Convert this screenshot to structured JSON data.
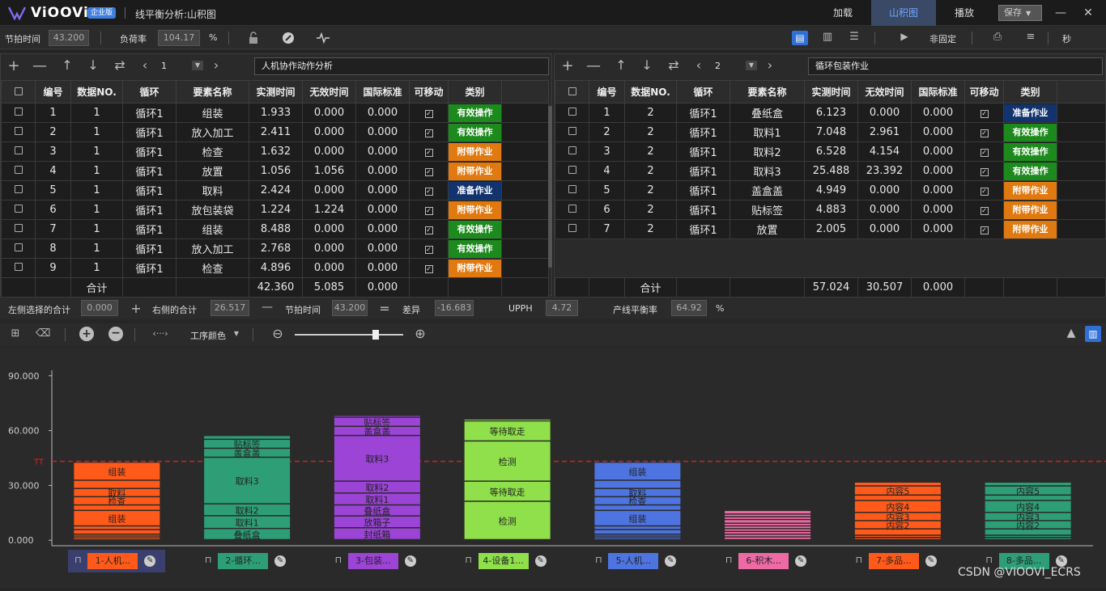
{
  "app": {
    "logo": "ViOOVi",
    "edition": "企业版",
    "title": "线平衡分析:山积图"
  },
  "titlebar": {
    "load": "加载",
    "yamazumi": "山积图",
    "play": "播放",
    "save": "保存"
  },
  "toolbar": {
    "takt_label": "节拍时间",
    "takt_value": "43.200",
    "load_label": "负荷率",
    "load_value": "104.17",
    "pct": "%",
    "mode": "非固定",
    "unit": "秒"
  },
  "left_panel": {
    "page": "1",
    "name": "人机协作动作分析",
    "headers": [
      "编号",
      "数据NO.",
      "循环",
      "要素名称",
      "实测时间",
      "无效时间",
      "国际标准",
      "可移动",
      "类别"
    ],
    "rows": [
      [
        "1",
        "1",
        "循环1",
        "组装",
        "1.933",
        "0.000",
        "0.000",
        "有效操作",
        "green"
      ],
      [
        "2",
        "1",
        "循环1",
        "放入加工",
        "2.411",
        "0.000",
        "0.000",
        "有效操作",
        "green"
      ],
      [
        "3",
        "1",
        "循环1",
        "检查",
        "1.632",
        "0.000",
        "0.000",
        "附带作业",
        "orange"
      ],
      [
        "4",
        "1",
        "循环1",
        "放置",
        "1.056",
        "1.056",
        "0.000",
        "附带作业",
        "orange"
      ],
      [
        "5",
        "1",
        "循环1",
        "取料",
        "2.424",
        "0.000",
        "0.000",
        "准备作业",
        "navy"
      ],
      [
        "6",
        "1",
        "循环1",
        "放包装袋",
        "1.224",
        "1.224",
        "0.000",
        "附带作业",
        "orange"
      ],
      [
        "7",
        "1",
        "循环1",
        "组装",
        "8.488",
        "0.000",
        "0.000",
        "有效操作",
        "green"
      ],
      [
        "8",
        "1",
        "循环1",
        "放入加工",
        "2.768",
        "0.000",
        "0.000",
        "有效操作",
        "green"
      ],
      [
        "9",
        "1",
        "循环1",
        "检查",
        "4.896",
        "0.000",
        "0.000",
        "附带作业",
        "orange"
      ]
    ],
    "total": {
      "label": "合计",
      "measured": "42.360",
      "invalid": "5.085",
      "standard": "0.000"
    }
  },
  "right_panel": {
    "page": "2",
    "name": "循环包装作业",
    "headers": [
      "编号",
      "数据NO.",
      "循环",
      "要素名称",
      "实测时间",
      "无效时间",
      "国际标准",
      "可移动",
      "类别"
    ],
    "rows": [
      [
        "1",
        "2",
        "循环1",
        "叠纸盒",
        "6.123",
        "0.000",
        "0.000",
        "准备作业",
        "navy"
      ],
      [
        "2",
        "2",
        "循环1",
        "取料1",
        "7.048",
        "2.961",
        "0.000",
        "有效操作",
        "green"
      ],
      [
        "3",
        "2",
        "循环1",
        "取料2",
        "6.528",
        "4.154",
        "0.000",
        "有效操作",
        "green"
      ],
      [
        "4",
        "2",
        "循环1",
        "取料3",
        "25.488",
        "23.392",
        "0.000",
        "有效操作",
        "green"
      ],
      [
        "5",
        "2",
        "循环1",
        "盖盒盖",
        "4.949",
        "0.000",
        "0.000",
        "附带作业",
        "orange"
      ],
      [
        "6",
        "2",
        "循环1",
        "贴标签",
        "4.883",
        "0.000",
        "0.000",
        "附带作业",
        "orange"
      ],
      [
        "7",
        "2",
        "循环1",
        "放置",
        "2.005",
        "0.000",
        "0.000",
        "附带作业",
        "orange"
      ]
    ],
    "total": {
      "label": "合计",
      "measured": "57.024",
      "invalid": "30.507",
      "standard": "0.000"
    }
  },
  "status": {
    "left_sum_label": "左侧选择的合计",
    "left_sum": "0.000",
    "right_sum_label": "右侧的合计",
    "right_sum": "26.517",
    "takt_label": "节拍时间",
    "takt": "43.200",
    "diff_label": "差异",
    "diff": "-16.683",
    "upph_label": "UPPH",
    "upph": "4.72",
    "balance_label": "产线平衡率",
    "balance": "64.92",
    "pct": "%"
  },
  "chart_toolbar": {
    "color_mode": "工序颜色"
  },
  "chart_data": {
    "type": "bar",
    "stacked": true,
    "ylim": [
      -3,
      93
    ],
    "yticks": [
      "0.000",
      "30.000",
      "60.000",
      "90.000"
    ],
    "takt_marker": "TT",
    "takt": 43.2,
    "bars": [
      {
        "label": "1-人机...",
        "color": "#ff5a1a",
        "total": 42.4,
        "segments": [
          {
            "n": "",
            "v": 1
          },
          {
            "n": "",
            "v": 1
          },
          {
            "n": "",
            "v": 1
          },
          {
            "n": "",
            "v": 2.5
          },
          {
            "n": "",
            "v": 2
          },
          {
            "n": "组装",
            "v": 8.5
          },
          {
            "n": "",
            "v": 3
          },
          {
            "n": "检查",
            "v": 4.5
          },
          {
            "n": "取料",
            "v": 4.5
          },
          {
            "n": "",
            "v": 4.5
          },
          {
            "n": "组装",
            "v": 9.9
          }
        ]
      },
      {
        "label": "2-循环...",
        "color": "#2e9e77",
        "total": 57.0,
        "segments": [
          {
            "n": "叠纸盒",
            "v": 6.1
          },
          {
            "n": "取料1",
            "v": 7
          },
          {
            "n": "取料2",
            "v": 6.5
          },
          {
            "n": "取料3",
            "v": 25.5
          },
          {
            "n": "盖盒盖",
            "v": 4.9
          },
          {
            "n": "贴标签",
            "v": 4.9
          },
          {
            "n": "",
            "v": 2.1
          }
        ]
      },
      {
        "label": "3-包装...",
        "color": "#9b44d6",
        "total": 68.0,
        "segments": [
          {
            "n": "封纸箱",
            "v": 6.5
          },
          {
            "n": "放箱子",
            "v": 6.5
          },
          {
            "n": "叠纸盒",
            "v": 6
          },
          {
            "n": "取料1",
            "v": 6.5
          },
          {
            "n": "取料2",
            "v": 6.5
          },
          {
            "n": "取料3",
            "v": 25
          },
          {
            "n": "盖盒盖",
            "v": 5
          },
          {
            "n": "贴标签",
            "v": 5
          },
          {
            "n": "",
            "v": 1
          }
        ]
      },
      {
        "label": "4-设备1...",
        "color": "#8fe04a",
        "total": 66.0,
        "segments": [
          {
            "n": "检测",
            "v": 21
          },
          {
            "n": "等待取走",
            "v": 11
          },
          {
            "n": "检测",
            "v": 22
          },
          {
            "n": "等待取走",
            "v": 11
          },
          {
            "n": "",
            "v": 1
          }
        ]
      },
      {
        "label": "5-人机...",
        "color": "#4d74e0",
        "total": 42.4,
        "segments": [
          {
            "n": "",
            "v": 1
          },
          {
            "n": "",
            "v": 1
          },
          {
            "n": "",
            "v": 1
          },
          {
            "n": "",
            "v": 2.5
          },
          {
            "n": "",
            "v": 2
          },
          {
            "n": "组装",
            "v": 8.5
          },
          {
            "n": "",
            "v": 3
          },
          {
            "n": "检查",
            "v": 4.5
          },
          {
            "n": "取料",
            "v": 4.5
          },
          {
            "n": "",
            "v": 4.5
          },
          {
            "n": "组装",
            "v": 9.9
          }
        ]
      },
      {
        "label": "6-积木...",
        "color": "#ee6aa4",
        "total": 16.0,
        "segments": [
          {
            "n": "",
            "v": 1.5
          },
          {
            "n": "",
            "v": 1.5
          },
          {
            "n": "",
            "v": 1.5
          },
          {
            "n": "",
            "v": 1.5
          },
          {
            "n": "",
            "v": 1.5
          },
          {
            "n": "",
            "v": 1.5
          },
          {
            "n": "",
            "v": 2
          },
          {
            "n": "",
            "v": 1.5
          },
          {
            "n": "",
            "v": 1.5
          },
          {
            "n": "",
            "v": 2
          }
        ]
      },
      {
        "label": "7-多品...",
        "color": "#ff5a1a",
        "total": 31.5,
        "segments": [
          {
            "n": "",
            "v": 1.2
          },
          {
            "n": "",
            "v": 1.2
          },
          {
            "n": "",
            "v": 3.5
          },
          {
            "n": "内容2",
            "v": 4.5
          },
          {
            "n": "内容3",
            "v": 4.5
          },
          {
            "n": "内容4",
            "v": 6.5
          },
          {
            "n": "",
            "v": 3
          },
          {
            "n": "内容5",
            "v": 5
          },
          {
            "n": "",
            "v": 2.1
          }
        ]
      },
      {
        "label": "8-多品...",
        "color": "#2e9e77",
        "total": 31.5,
        "segments": [
          {
            "n": "",
            "v": 1.2
          },
          {
            "n": "",
            "v": 1.2
          },
          {
            "n": "",
            "v": 3.5
          },
          {
            "n": "内容2",
            "v": 4.5
          },
          {
            "n": "内容3",
            "v": 4.5
          },
          {
            "n": "内容4",
            "v": 6.5
          },
          {
            "n": "",
            "v": 3
          },
          {
            "n": "内容5",
            "v": 5
          },
          {
            "n": "",
            "v": 2.1
          }
        ]
      }
    ]
  },
  "watermark": "CSDN @VIOOVI_ECRS"
}
